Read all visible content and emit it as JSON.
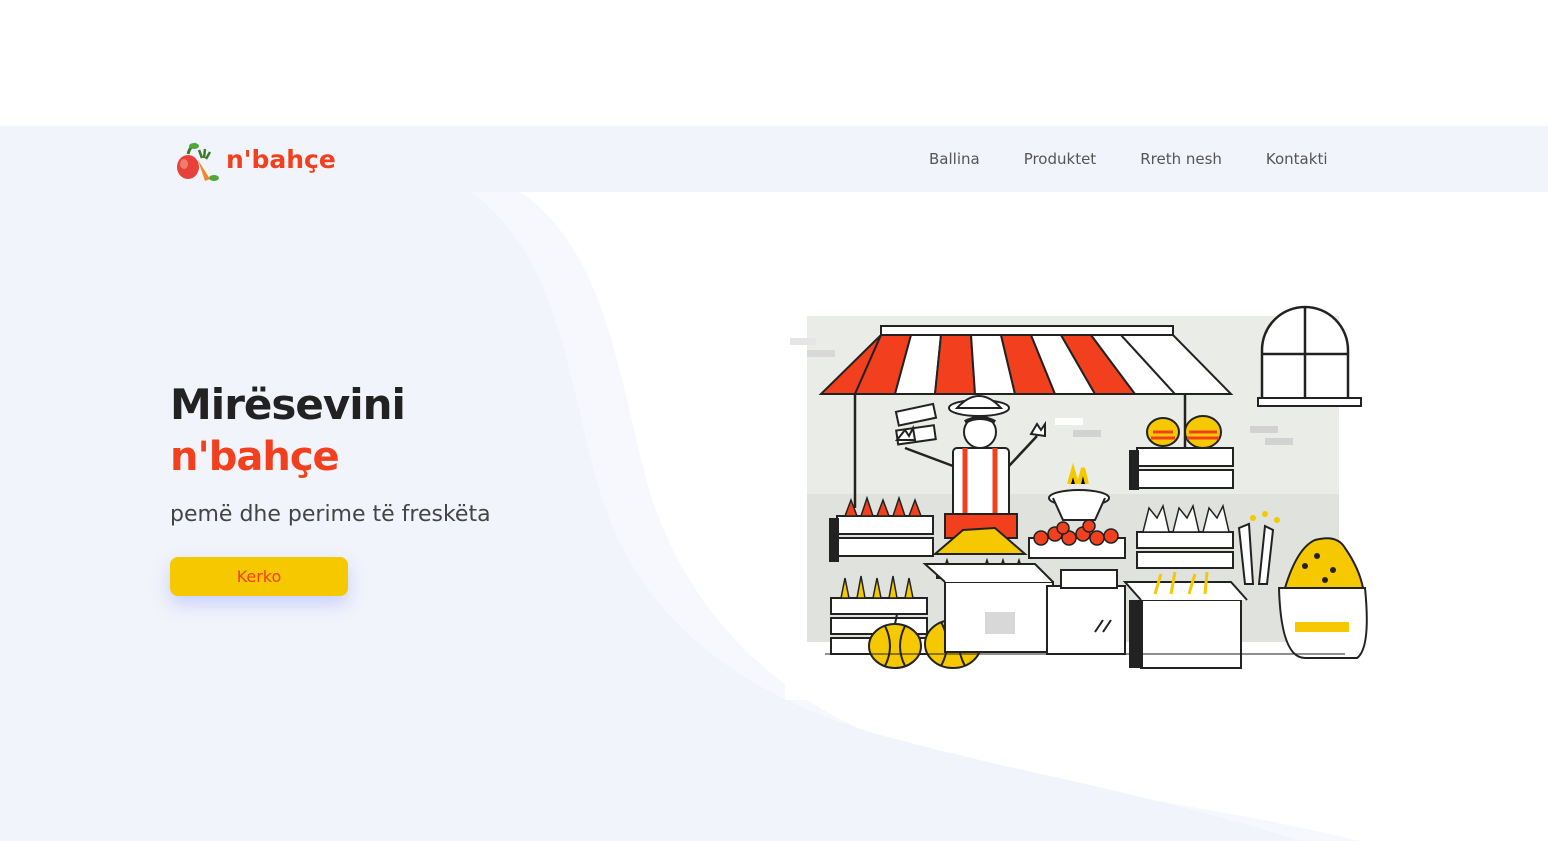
{
  "brand": {
    "name": "n'bahçe"
  },
  "nav": {
    "items": [
      {
        "label": "Ballina"
      },
      {
        "label": "Produktet"
      },
      {
        "label": "Rreth nesh"
      },
      {
        "label": "Kontakti"
      }
    ]
  },
  "hero": {
    "title_line1": "Mirësevini",
    "title_line2": "n'bahçe",
    "subtitle": "pemë dhe perime të freskëta",
    "cta_label": "Kerko"
  },
  "colors": {
    "accent": "#f2401f",
    "cta_bg": "#f5c800",
    "nav_bg": "#f2f4fb",
    "text_dark": "#222222"
  },
  "icons": {
    "logo": "fruit-vegetable-logo-icon",
    "illustration": "market-stall-illustration"
  }
}
